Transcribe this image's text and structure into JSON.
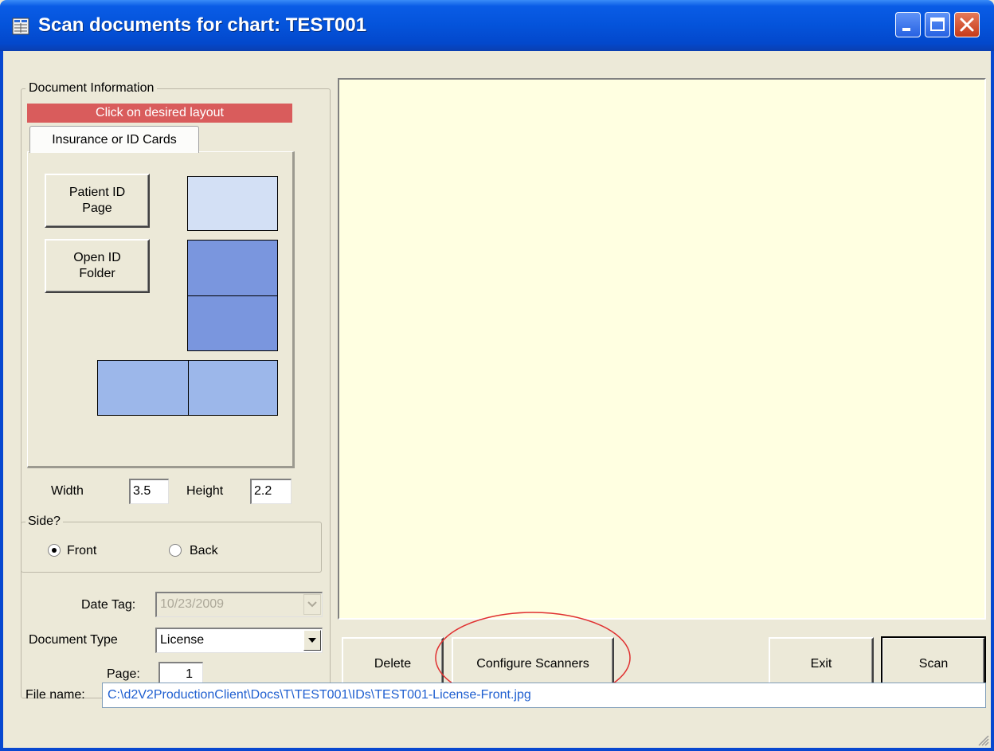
{
  "window": {
    "title": "Scan documents for chart: TEST001"
  },
  "document_info": {
    "group_label": "Document Information",
    "banner": "Click on desired layout",
    "tab_label": "Insurance or ID Cards",
    "patient_id_button": "Patient ID\nPage",
    "open_id_folder_button": "Open ID\nFolder"
  },
  "dimensions": {
    "width_label": "Width",
    "width_value": "3.5",
    "height_label": "Height",
    "height_value": "2.2"
  },
  "side": {
    "label": "Side?",
    "front_label": "Front",
    "back_label": "Back",
    "selected": "Front"
  },
  "date_tag": {
    "label": "Date Tag:",
    "value": "10/23/2009"
  },
  "document_type": {
    "label": "Document Type",
    "value": "License"
  },
  "page": {
    "label": "Page:",
    "value": "1"
  },
  "actions": {
    "delete": "Delete",
    "configure_scanners": "Configure Scanners",
    "exit": "Exit",
    "scan": "Scan"
  },
  "file": {
    "label": "File name:",
    "path": "C:\\d2V2ProductionClient\\Docs\\T\\TEST001\\IDs\\TEST001-License-Front.jpg"
  },
  "colors": {
    "banner": "#D95C5C",
    "preview_bg": "#FFFFE1",
    "layout_light": "#D3E0F5",
    "layout_dark": "#7A96DE",
    "layout_mid": "#9CB7EA",
    "annotation_circle": "#E03030"
  }
}
